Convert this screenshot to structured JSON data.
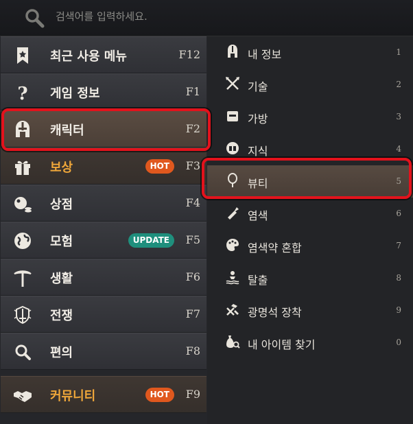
{
  "search": {
    "placeholder": "검색어를 입력하세요."
  },
  "left_menu": [
    {
      "label": "최근 사용 메뉴",
      "key": "F12",
      "icon": "bookmark-star-icon"
    },
    {
      "label": "게임 정보",
      "key": "F1",
      "icon": "question-icon"
    },
    {
      "label": "캐릭터",
      "key": "F2",
      "icon": "helmet-icon",
      "selected": true
    },
    {
      "label": "보상",
      "key": "F3",
      "icon": "gift-icon",
      "badge": "HOT"
    },
    {
      "label": "상점",
      "key": "F4",
      "icon": "coins-icon"
    },
    {
      "label": "모험",
      "key": "F5",
      "icon": "map-icon",
      "badge": "UPDATE"
    },
    {
      "label": "생활",
      "key": "F6",
      "icon": "pickaxe-icon"
    },
    {
      "label": "전쟁",
      "key": "F7",
      "icon": "sword-shield-icon"
    },
    {
      "label": "편의",
      "key": "F8",
      "icon": "search-icon"
    },
    {
      "label": "커뮤니티",
      "key": "F9",
      "icon": "handshake-icon",
      "badge": "HOT"
    }
  ],
  "sub_menu": [
    {
      "label": "내 정보",
      "key": "1",
      "icon": "helmet-icon"
    },
    {
      "label": "기술",
      "key": "2",
      "icon": "crossed-weapons-icon"
    },
    {
      "label": "가방",
      "key": "3",
      "icon": "bag-icon"
    },
    {
      "label": "지식",
      "key": "4",
      "icon": "book-icon"
    },
    {
      "label": "뷰티",
      "key": "5",
      "icon": "mirror-icon",
      "selected": true
    },
    {
      "label": "염색",
      "key": "6",
      "icon": "brush-icon"
    },
    {
      "label": "염색약 혼합",
      "key": "7",
      "icon": "palette-icon"
    },
    {
      "label": "탈출",
      "key": "8",
      "icon": "escape-icon"
    },
    {
      "label": "광명석 장착",
      "key": "9",
      "icon": "tools-icon"
    },
    {
      "label": "내 아이템 찾기",
      "key": "0",
      "icon": "item-search-icon"
    }
  ],
  "colors": {
    "highlight_outline": "#e3121c",
    "hot_badge": "#e0581e",
    "update_badge": "#1f8f7d",
    "accent_text": "#f0a73a"
  }
}
